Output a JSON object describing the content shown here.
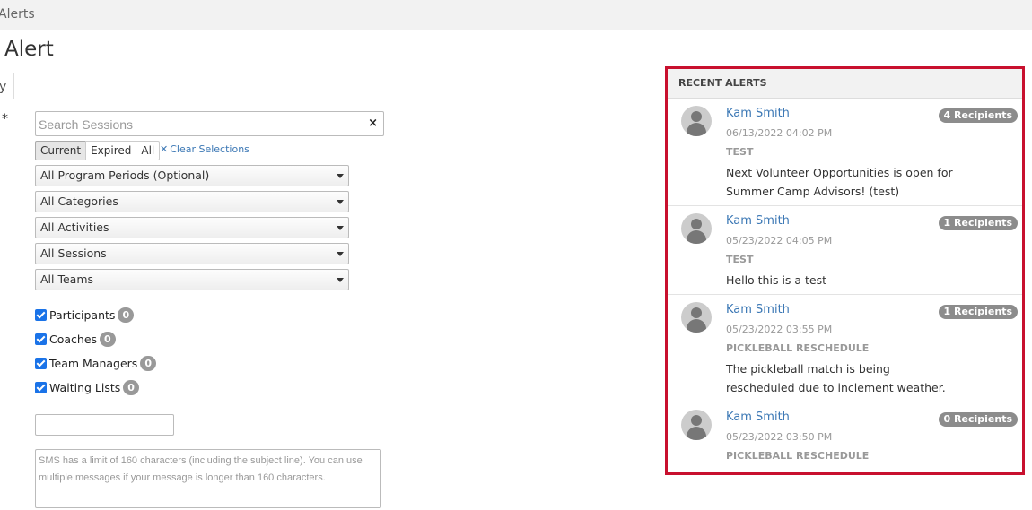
{
  "breadcrumb": {
    "current": "Alerts"
  },
  "page": {
    "title": "Alert"
  },
  "tab": {
    "label": "y"
  },
  "form": {
    "required_mark": "*",
    "search": {
      "placeholder": "Search Sessions",
      "clear_icon": "×"
    },
    "session_filter": {
      "options": [
        "Current",
        "Expired",
        "All"
      ],
      "selected": "Current"
    },
    "clear_selections": "Clear Selections",
    "dropdowns": [
      {
        "value": "All Program Periods (Optional)"
      },
      {
        "value": "All Categories"
      },
      {
        "value": "All Activities"
      },
      {
        "value": "All Sessions"
      },
      {
        "value": "All Teams"
      }
    ],
    "recipients": [
      {
        "label": "Participants",
        "count": "0",
        "checked": true
      },
      {
        "label": "Coaches",
        "count": "0",
        "checked": true
      },
      {
        "label": "Team Managers",
        "count": "0",
        "checked": true
      },
      {
        "label": "Waiting Lists",
        "count": "0",
        "checked": true
      }
    ],
    "subject_value": "",
    "message_placeholder": "SMS has a limit of 160 characters (including the subject line). You can use multiple messages if your message is longer than 160 characters."
  },
  "recent_alerts": {
    "header": "RECENT ALERTS",
    "items": [
      {
        "name": "Kam Smith",
        "recipients": "4 Recipients",
        "date": "06/13/2022 04:02 PM",
        "subject": "TEST",
        "message": "Next Volunteer Opportunities is open for Summer Camp Advisors! (test)"
      },
      {
        "name": "Kam Smith",
        "recipients": "1 Recipients",
        "date": "05/23/2022 04:05 PM",
        "subject": "TEST",
        "message": "Hello this is a test"
      },
      {
        "name": "Kam Smith",
        "recipients": "1 Recipients",
        "date": "05/23/2022 03:55 PM",
        "subject": "PICKLEBALL RESCHEDULE",
        "message": "The pickleball match is being rescheduled due to inclement weather."
      },
      {
        "name": "Kam Smith",
        "recipients": "0 Recipients",
        "date": "05/23/2022 03:50 PM",
        "subject": "PICKLEBALL RESCHEDULE",
        "message": ""
      }
    ]
  },
  "colors": {
    "accent_link": "#3c78b5",
    "panel_border": "#c8102e",
    "checkbox": "#1a73e8",
    "badge": "#8c8c8c"
  }
}
